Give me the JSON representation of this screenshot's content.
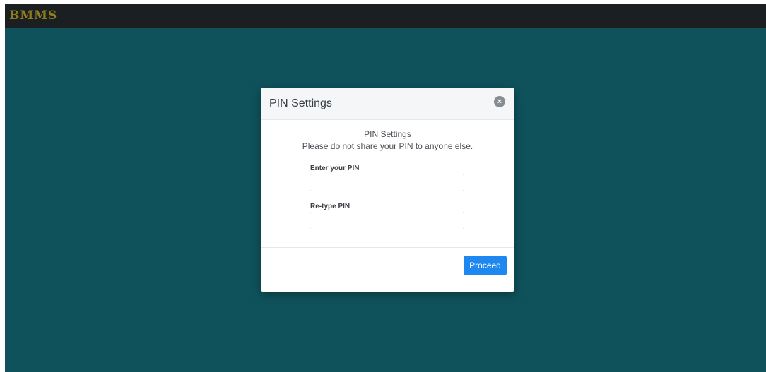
{
  "app": {
    "brand": "BMMS"
  },
  "modal": {
    "title": "PIN Settings",
    "close_icon": "×",
    "body_title": "PIN Settings",
    "body_note": "Please do not share your PIN to anyone else.",
    "pin_label": "Enter your PIN",
    "pin_value": "",
    "retype_label": "Re-type PIN",
    "retype_value": "",
    "proceed_label": "Proceed"
  },
  "colors": {
    "background": "#0f525c",
    "topbar": "#1c1f22",
    "brand": "#8e7d1e",
    "primary_button": "#1e88f0"
  }
}
